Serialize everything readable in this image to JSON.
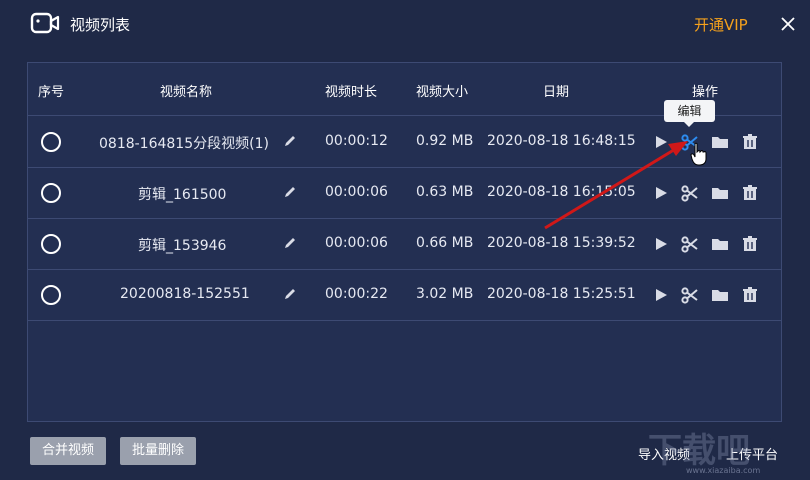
{
  "window": {
    "title": "视频列表",
    "vip": "开通VIP",
    "vip_color": "#f5a11c",
    "close_icon": "close-icon"
  },
  "table": {
    "headers": [
      "序号",
      "视频名称",
      "视频时长",
      "视频大小",
      "日期",
      "操作"
    ],
    "rows": [
      {
        "name": "0818-164815分段视频(1)",
        "duration": "00:00:12",
        "size": "0.92 MB",
        "date": "2020-08-18 16:48:15"
      },
      {
        "name": "剪辑_161500",
        "duration": "00:00:06",
        "size": "0.63 MB",
        "date": "2020-08-18 16:15:05"
      },
      {
        "name": "剪辑_153946",
        "duration": "00:00:06",
        "size": "0.66 MB",
        "date": "2020-08-18 15:39:52"
      },
      {
        "name": "20200818-152551",
        "duration": "00:00:22",
        "size": "3.02 MB",
        "date": "2020-08-18 15:25:51"
      }
    ],
    "tooltip": "编辑",
    "active_color": "#2d8cf0"
  },
  "footer": {
    "merge": "合并视频",
    "batch_delete": "批量删除",
    "import": "导入视频",
    "upload": "上传平台"
  },
  "watermark": {
    "text": "下载吧",
    "url": "www.xiazaiba.com"
  }
}
